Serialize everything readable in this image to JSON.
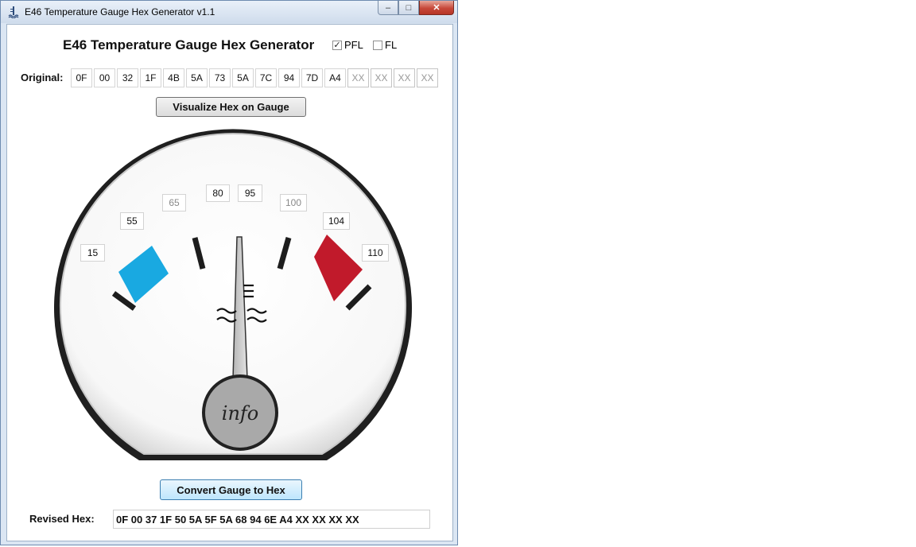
{
  "window": {
    "title": "E46 Temperature Gauge Hex Generator v1.1",
    "minimize": "–",
    "maximize": "□",
    "close": "✕"
  },
  "header": {
    "title": "E46 Temperature Gauge Hex Generator",
    "pfl": {
      "label": "PFL",
      "checked": true
    },
    "fl": {
      "label": "FL",
      "checked": false
    }
  },
  "original": {
    "label": "Original:",
    "bytes": [
      "0F",
      "00",
      "32",
      "1F",
      "4B",
      "5A",
      "73",
      "5A",
      "7C",
      "94",
      "7D",
      "A4",
      "XX",
      "XX",
      "XX",
      "XX"
    ]
  },
  "visualize_button": "Visualize Hex on Gauge",
  "gauge": {
    "labels": [
      "15",
      "55",
      "65",
      "80",
      "95",
      "100",
      "104",
      "110"
    ],
    "center_text": "info",
    "cold_color": "#19a9e1",
    "hot_color": "#c11a2b",
    "needle_value": "80"
  },
  "convert_button": "Convert Gauge to Hex",
  "revised": {
    "label": "Revised Hex:",
    "value": "0F 00 37 1F 50 5A 5F 5A 68 94 6E A4 XX XX XX XX"
  }
}
